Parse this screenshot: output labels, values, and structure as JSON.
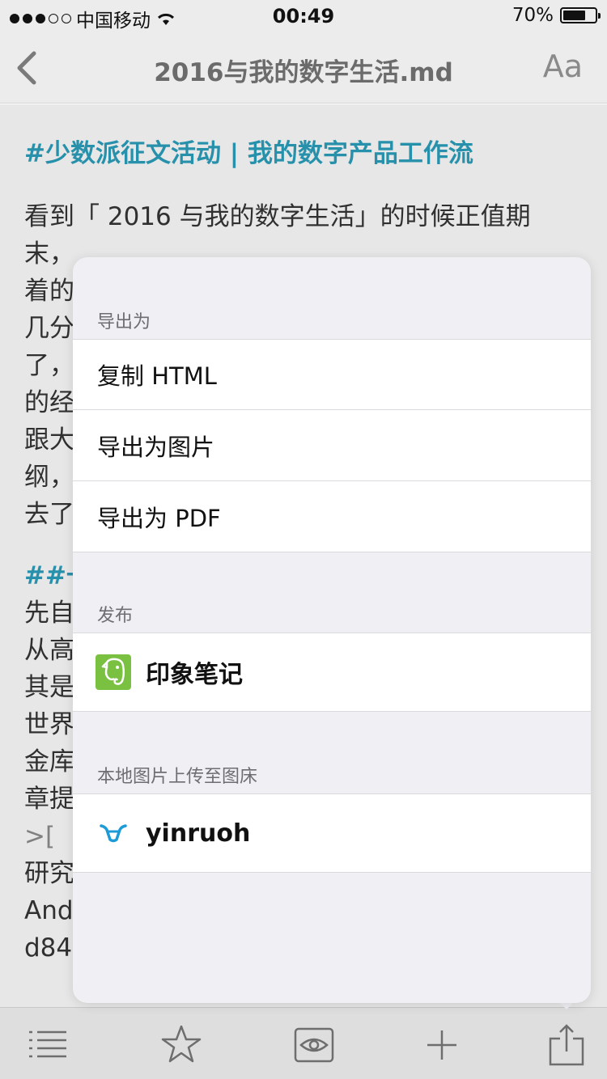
{
  "status_bar": {
    "carrier": "中国移动",
    "time": "00:49",
    "battery_percent": "70%",
    "battery_level": 0.7,
    "signal_bars_filled": 3,
    "signal_bars_total": 5
  },
  "nav": {
    "title": "2016与我的数字生活.md",
    "font_button": "Aa"
  },
  "document": {
    "heading1": "#少数派征文活动 | 我的数字产品工作流",
    "paragraph1_lines": [
      "看到「 2016 与我的数字生活」的时候正值期",
      "末，",
      "着的",
      "几分",
      "了，",
      "的经",
      "跟大",
      "纲，",
      "去了"
    ],
    "heading2": "##一",
    "paragraph2_lines": [
      "先自",
      "从高",
      "其是",
      "世界",
      "金库",
      "章提"
    ],
    "quote_line": ">[ 「",
    "tail_lines": [
      "研究",
      "And",
      "d84"
    ]
  },
  "popover": {
    "section_export": "导出为",
    "export_items": [
      "复制 HTML",
      "导出为图片",
      "导出为 PDF"
    ],
    "section_publish": "发布",
    "publish_item": "印象笔记",
    "section_upload": "本地图片上传至图床",
    "upload_item": "yinruoh"
  },
  "toolbar": {
    "icons": [
      "list-icon",
      "star-icon",
      "eye-icon",
      "plus-icon",
      "share-icon"
    ]
  },
  "colors": {
    "accent": "#2a9bb7",
    "evernote": "#7ac142",
    "weibo": "#1d9bd7"
  }
}
